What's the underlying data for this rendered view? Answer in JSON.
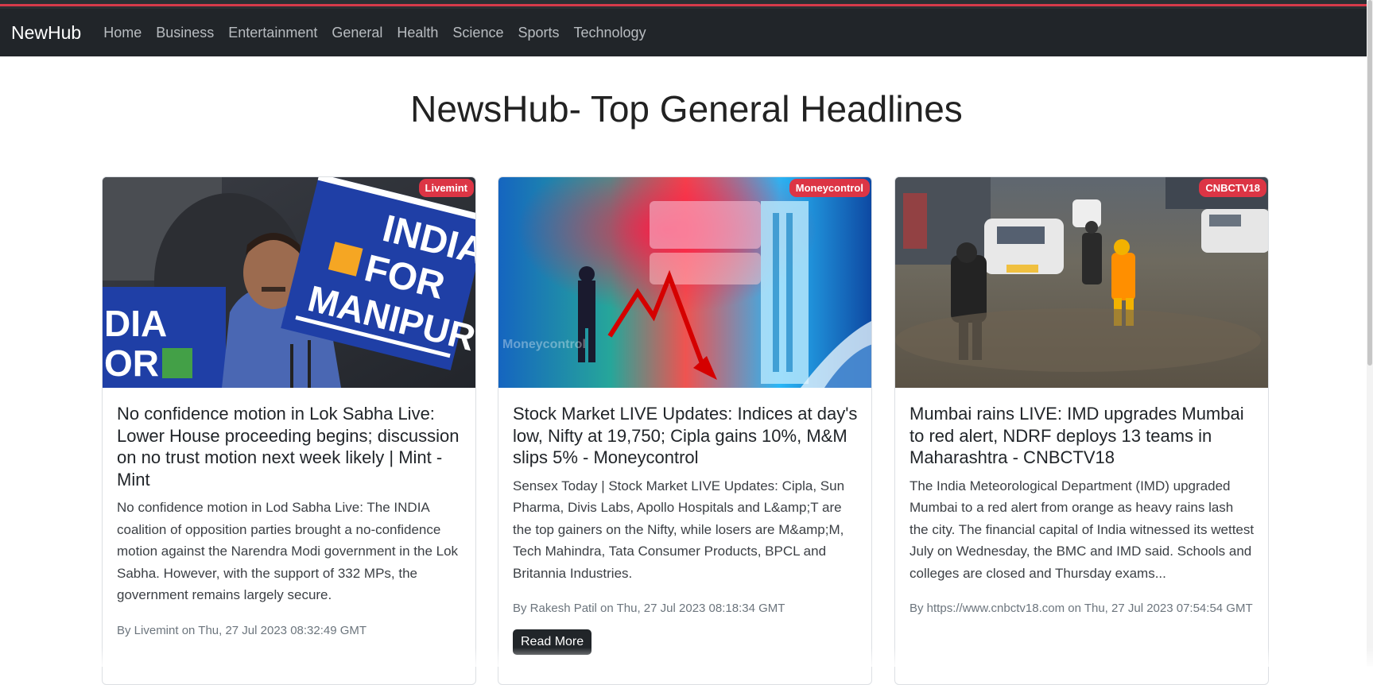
{
  "navbar": {
    "brand": "NewHub",
    "links": [
      "Home",
      "Business",
      "Entertainment",
      "General",
      "Health",
      "Science",
      "Sports",
      "Technology"
    ]
  },
  "page_title": "NewsHub- Top General Headlines",
  "articles": [
    {
      "source": "Livemint",
      "title": "No confidence motion in Lok Sabha Live: Lower House proceeding begins; discussion on no trust motion next week likely | Mint - Mint",
      "description": "No confidence motion in Lod Sabha Live: The INDIA coalition of opposition parties brought a no-confidence motion against the Narendra Modi government in the Lok Sabha. However, with the support of 332 MPs, the government remains largely secure.",
      "meta": "By Livemint on Thu, 27 Jul 2023 08:32:49 GMT",
      "image_text": [
        "INDIA",
        "FOR",
        "MANIPUR",
        "DIA",
        "OR"
      ]
    },
    {
      "source": "Moneycontrol",
      "title": "Stock Market LIVE Updates: Indices at day's low, Nifty at 19,750; Cipla gains 10%, M&M slips 5% - Moneycontrol",
      "description": "Sensex Today | Stock Market LIVE Updates: Cipla, Sun Pharma, Divis Labs, Apollo Hospitals and L&amp;T are the top gainers on the Nifty, while losers are M&amp;M, Tech Mahindra, Tata Consumer Products, BPCL and Britannia Industries.",
      "meta": "By Rakesh Patil on Thu, 27 Jul 2023 08:18:34 GMT",
      "read_more": "Read More",
      "image_text": [
        "Moneycontrol"
      ]
    },
    {
      "source": "CNBCTV18",
      "title": "Mumbai rains LIVE: IMD upgrades Mumbai to red alert, NDRF deploys 13 teams in Maharashtra - CNBCTV18",
      "description": "The India Meteorological Department (IMD) upgraded Mumbai to a red alert from orange as heavy rains lash the city. The financial capital of India witnessed its wettest July on Wednesday, the BMC and IMD said. Schools and colleges are closed and Thursday exams...",
      "meta": "By https://www.cnbctv18.com on Thu, 27 Jul 2023 07:54:54 GMT"
    }
  ],
  "colors": {
    "navbar_bg": "#212529",
    "accent_line": "#d63a4a",
    "badge_bg": "#dc3545",
    "button_bg": "#212529"
  }
}
